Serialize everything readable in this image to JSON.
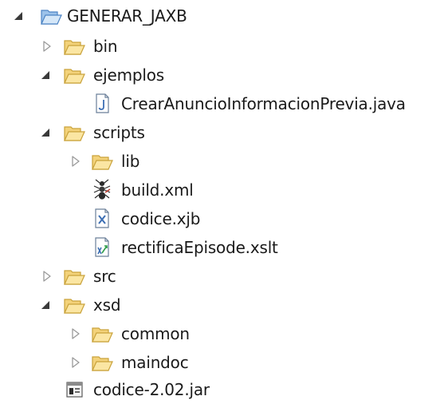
{
  "explorer": {
    "project": {
      "label": "GENERAR_JAXB",
      "expanded": true,
      "children": {
        "bin": {
          "label": "bin",
          "expanded": false
        },
        "ejemplos": {
          "label": "ejemplos",
          "expanded": true,
          "children": {
            "java_file": {
              "label": "CrearAnuncioInformacionPrevia.java"
            }
          }
        },
        "scripts": {
          "label": "scripts",
          "expanded": true,
          "children": {
            "lib": {
              "label": "lib",
              "expanded": false
            },
            "build": {
              "label": "build.xml"
            },
            "xjb": {
              "label": "codice.xjb"
            },
            "xslt": {
              "label": "rectificaEpisode.xslt"
            }
          }
        },
        "src": {
          "label": "src",
          "expanded": false
        },
        "xsd": {
          "label": "xsd",
          "expanded": true,
          "children": {
            "common": {
              "label": "common",
              "expanded": false
            },
            "maindoc": {
              "label": "maindoc",
              "expanded": false
            }
          }
        },
        "jar": {
          "label": "codice-2.02.jar"
        }
      }
    },
    "colors": {
      "folder_fill": "#fbe6a3",
      "folder_stroke": "#c9a23a",
      "project_fill": "#b9d6f2",
      "project_stroke": "#4d84c4",
      "arrow_expanded": "#3a3a3a",
      "arrow_collapsed": "#9a9a9a"
    }
  }
}
